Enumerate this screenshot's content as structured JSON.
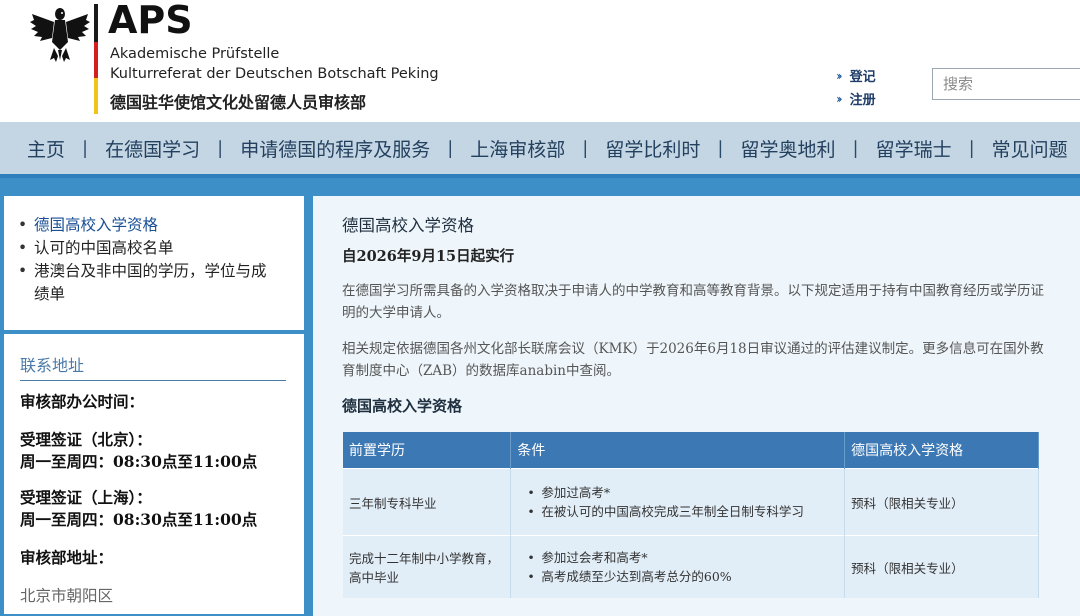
{
  "header": {
    "title": "APS",
    "line1": "Akademische Prüfstelle",
    "line2": "Kulturreferat der Deutschen Botschaft Peking",
    "line3": "德国驻华使馆文化处留德人员审核部",
    "login": "登记",
    "register": "注册",
    "search_placeholder": "搜索"
  },
  "nav": {
    "items": [
      "主页",
      "在德国学习",
      "申请德国的程序及服务",
      "上海审核部",
      "留学比利时",
      "留学奥地利",
      "留学瑞士",
      "常见问题"
    ]
  },
  "sidebar": {
    "links": [
      "德国高校入学资格",
      "认可的中国高校名单",
      "港澳台及非中国的学历，学位与成",
      "绩单"
    ],
    "contact": {
      "title": "联系地址",
      "hours_label": "审核部办公时间：",
      "beijing_label": "受理签证（北京）：",
      "beijing_hours": "周一至周四：08:30点至11:00点",
      "shanghai_label": "受理签证（上海）：",
      "shanghai_hours": "周一至周四：08:30点至11:00点",
      "address_label": "审核部地址：",
      "address": "北京市朝阳区"
    }
  },
  "main": {
    "title": "德国高校入学资格",
    "date": "自2026年9月15日起实行",
    "p1": "在德国学习所需具备的入学资格取决于申请人的中学教育和高等教育背景。以下规定适用于持有中国教育经历或学历证明的大学申请人。",
    "p2": "相关规定依据德国各州文化部长联席会议（KMK）于2026年6月18日审议通过的评估建议制定。更多信息可在国外教育制度中心（ZAB）的数据库anabin中查阅。",
    "subtitle": "德国高校入学资格",
    "table": {
      "headers": [
        "前置学历",
        "条件",
        "德国高校入学资格"
      ],
      "rows": [
        {
          "edu": "三年制专科毕业",
          "conditions": [
            "参加过高考*",
            "在被认可的中国高校完成三年制全日制专科学习"
          ],
          "result": "预科（限相关专业）"
        },
        {
          "edu": "完成十二年制中小学教育，高中毕业",
          "conditions": [
            "参加过会考和高考*",
            "高考成绩至少达到高考总分的60%"
          ],
          "result": "预科（限相关专业）"
        }
      ]
    }
  }
}
